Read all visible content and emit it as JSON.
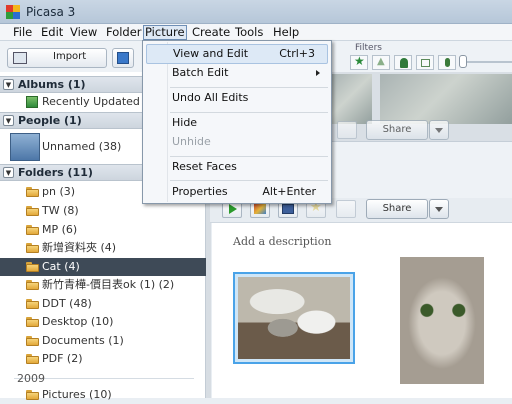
{
  "window": {
    "title": "Picasa 3"
  },
  "menubar": [
    "File",
    "Edit",
    "View",
    "Folder",
    "Picture",
    "Create",
    "Tools",
    "Help"
  ],
  "toolbar": {
    "import_label": "Import"
  },
  "filters": {
    "label": "Filters"
  },
  "sidebar": {
    "albums": {
      "header": "Albums (1)",
      "items": [
        "Recently Updated (15"
      ]
    },
    "people": {
      "header": "People (1)",
      "items": [
        "Unnamed (38)"
      ]
    },
    "folders": {
      "header": "Folders (11)",
      "items": [
        "pn (3)",
        "TW (8)",
        "MP (6)",
        "新增資料夾 (4)",
        "Cat (4)",
        "新竹青樺-價目表ok (1) (2)",
        "DDT (48)",
        "Desktop (10)",
        "Documents (1)",
        "PDF (2)"
      ],
      "selected": "Cat (4)"
    },
    "year": "2009",
    "next_partial": "Pictures (10)"
  },
  "content": {
    "share_label": "Share",
    "description_placeholder": "Add a description"
  },
  "picture_menu": {
    "items": [
      {
        "label": "View and Edit",
        "shortcut": "Ctrl+3"
      },
      {
        "label": "Batch Edit",
        "shortcut": ""
      },
      {
        "label": "Undo All Edits",
        "shortcut": ""
      },
      {
        "label": "Hide",
        "shortcut": ""
      },
      {
        "label": "Unhide",
        "shortcut": ""
      },
      {
        "label": "Reset Faces",
        "shortcut": ""
      },
      {
        "label": "Properties",
        "shortcut": "Alt+Enter"
      }
    ]
  },
  "colors": {
    "selection_bg": "#3e4a57",
    "thumb_selected_border": "#4aa3e8",
    "menu_hover": "#dde9f6"
  }
}
